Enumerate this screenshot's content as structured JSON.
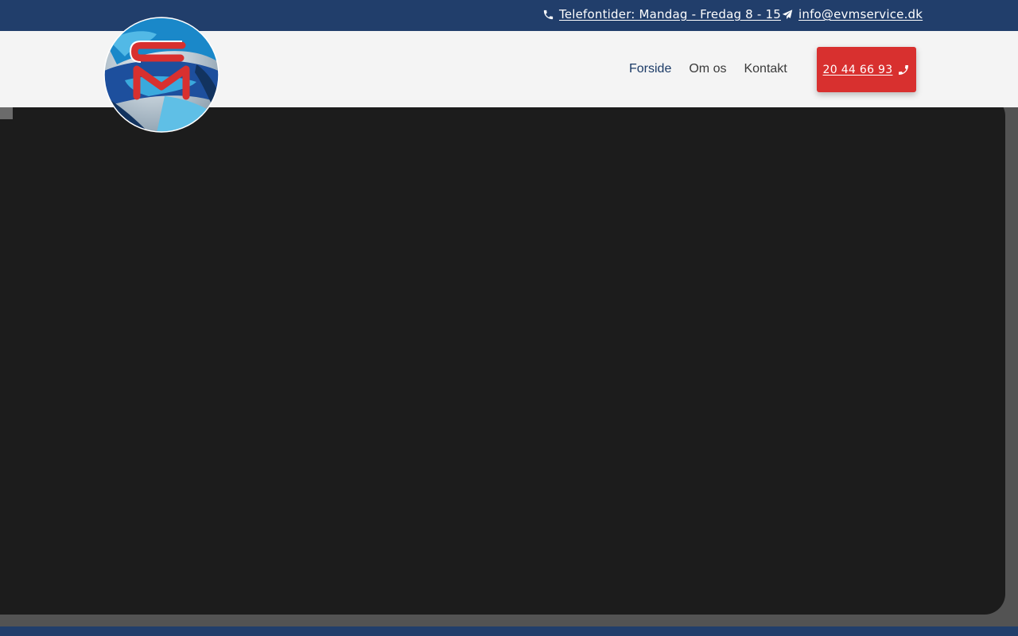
{
  "topbar": {
    "phone_icon": "phone-icon",
    "phone_text": "Telefontider: Mandag - Fredag 8 - 15",
    "email_icon": "paper-plane-icon",
    "email_text": "info@evmservice.dk"
  },
  "logo": {
    "icon": "globe-logo"
  },
  "nav": {
    "items": [
      {
        "label": "Forside",
        "active": true
      },
      {
        "label": "Om os",
        "active": false
      },
      {
        "label": "Kontakt",
        "active": false
      }
    ]
  },
  "cta": {
    "label": "20 44 66 93",
    "icon": "phone-icon"
  },
  "colors": {
    "topbar": "#213e6b",
    "header": "#f4f4f4",
    "accent_red": "#d8302f",
    "nav_active": "#1b3a66",
    "video_bg": "#1c1c1c",
    "page_bg": "#535353"
  }
}
